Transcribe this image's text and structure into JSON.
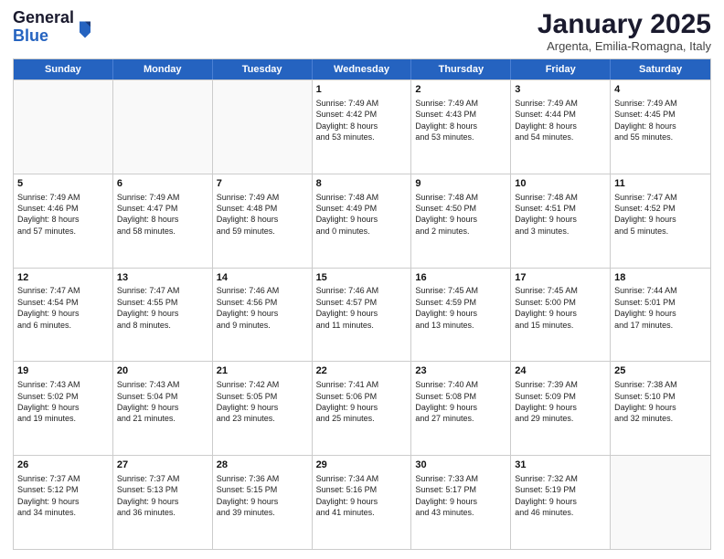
{
  "logo": {
    "general": "General",
    "blue": "Blue"
  },
  "title": "January 2025",
  "location": "Argenta, Emilia-Romagna, Italy",
  "weekdays": [
    "Sunday",
    "Monday",
    "Tuesday",
    "Wednesday",
    "Thursday",
    "Friday",
    "Saturday"
  ],
  "rows": [
    [
      {
        "day": "",
        "text": "",
        "empty": true
      },
      {
        "day": "",
        "text": "",
        "empty": true
      },
      {
        "day": "",
        "text": "",
        "empty": true
      },
      {
        "day": "1",
        "text": "Sunrise: 7:49 AM\nSunset: 4:42 PM\nDaylight: 8 hours\nand 53 minutes."
      },
      {
        "day": "2",
        "text": "Sunrise: 7:49 AM\nSunset: 4:43 PM\nDaylight: 8 hours\nand 53 minutes."
      },
      {
        "day": "3",
        "text": "Sunrise: 7:49 AM\nSunset: 4:44 PM\nDaylight: 8 hours\nand 54 minutes."
      },
      {
        "day": "4",
        "text": "Sunrise: 7:49 AM\nSunset: 4:45 PM\nDaylight: 8 hours\nand 55 minutes."
      }
    ],
    [
      {
        "day": "5",
        "text": "Sunrise: 7:49 AM\nSunset: 4:46 PM\nDaylight: 8 hours\nand 57 minutes."
      },
      {
        "day": "6",
        "text": "Sunrise: 7:49 AM\nSunset: 4:47 PM\nDaylight: 8 hours\nand 58 minutes."
      },
      {
        "day": "7",
        "text": "Sunrise: 7:49 AM\nSunset: 4:48 PM\nDaylight: 8 hours\nand 59 minutes."
      },
      {
        "day": "8",
        "text": "Sunrise: 7:48 AM\nSunset: 4:49 PM\nDaylight: 9 hours\nand 0 minutes."
      },
      {
        "day": "9",
        "text": "Sunrise: 7:48 AM\nSunset: 4:50 PM\nDaylight: 9 hours\nand 2 minutes."
      },
      {
        "day": "10",
        "text": "Sunrise: 7:48 AM\nSunset: 4:51 PM\nDaylight: 9 hours\nand 3 minutes."
      },
      {
        "day": "11",
        "text": "Sunrise: 7:47 AM\nSunset: 4:52 PM\nDaylight: 9 hours\nand 5 minutes."
      }
    ],
    [
      {
        "day": "12",
        "text": "Sunrise: 7:47 AM\nSunset: 4:54 PM\nDaylight: 9 hours\nand 6 minutes."
      },
      {
        "day": "13",
        "text": "Sunrise: 7:47 AM\nSunset: 4:55 PM\nDaylight: 9 hours\nand 8 minutes."
      },
      {
        "day": "14",
        "text": "Sunrise: 7:46 AM\nSunset: 4:56 PM\nDaylight: 9 hours\nand 9 minutes."
      },
      {
        "day": "15",
        "text": "Sunrise: 7:46 AM\nSunset: 4:57 PM\nDaylight: 9 hours\nand 11 minutes."
      },
      {
        "day": "16",
        "text": "Sunrise: 7:45 AM\nSunset: 4:59 PM\nDaylight: 9 hours\nand 13 minutes."
      },
      {
        "day": "17",
        "text": "Sunrise: 7:45 AM\nSunset: 5:00 PM\nDaylight: 9 hours\nand 15 minutes."
      },
      {
        "day": "18",
        "text": "Sunrise: 7:44 AM\nSunset: 5:01 PM\nDaylight: 9 hours\nand 17 minutes."
      }
    ],
    [
      {
        "day": "19",
        "text": "Sunrise: 7:43 AM\nSunset: 5:02 PM\nDaylight: 9 hours\nand 19 minutes."
      },
      {
        "day": "20",
        "text": "Sunrise: 7:43 AM\nSunset: 5:04 PM\nDaylight: 9 hours\nand 21 minutes."
      },
      {
        "day": "21",
        "text": "Sunrise: 7:42 AM\nSunset: 5:05 PM\nDaylight: 9 hours\nand 23 minutes."
      },
      {
        "day": "22",
        "text": "Sunrise: 7:41 AM\nSunset: 5:06 PM\nDaylight: 9 hours\nand 25 minutes."
      },
      {
        "day": "23",
        "text": "Sunrise: 7:40 AM\nSunset: 5:08 PM\nDaylight: 9 hours\nand 27 minutes."
      },
      {
        "day": "24",
        "text": "Sunrise: 7:39 AM\nSunset: 5:09 PM\nDaylight: 9 hours\nand 29 minutes."
      },
      {
        "day": "25",
        "text": "Sunrise: 7:38 AM\nSunset: 5:10 PM\nDaylight: 9 hours\nand 32 minutes."
      }
    ],
    [
      {
        "day": "26",
        "text": "Sunrise: 7:37 AM\nSunset: 5:12 PM\nDaylight: 9 hours\nand 34 minutes."
      },
      {
        "day": "27",
        "text": "Sunrise: 7:37 AM\nSunset: 5:13 PM\nDaylight: 9 hours\nand 36 minutes."
      },
      {
        "day": "28",
        "text": "Sunrise: 7:36 AM\nSunset: 5:15 PM\nDaylight: 9 hours\nand 39 minutes."
      },
      {
        "day": "29",
        "text": "Sunrise: 7:34 AM\nSunset: 5:16 PM\nDaylight: 9 hours\nand 41 minutes."
      },
      {
        "day": "30",
        "text": "Sunrise: 7:33 AM\nSunset: 5:17 PM\nDaylight: 9 hours\nand 43 minutes."
      },
      {
        "day": "31",
        "text": "Sunrise: 7:32 AM\nSunset: 5:19 PM\nDaylight: 9 hours\nand 46 minutes."
      },
      {
        "day": "",
        "text": "",
        "empty": true
      }
    ]
  ]
}
